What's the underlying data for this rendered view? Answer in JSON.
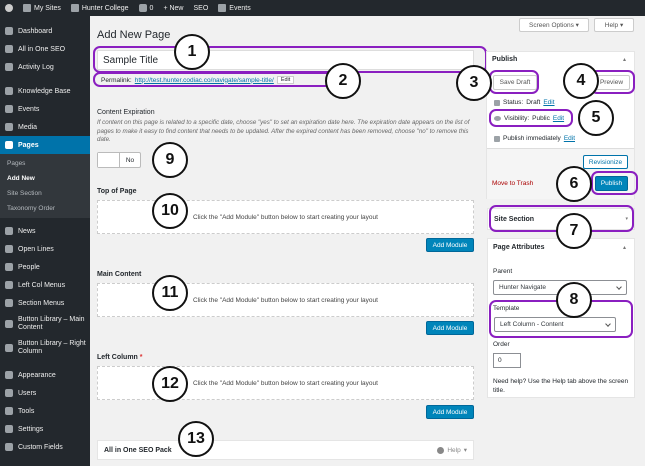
{
  "admin_bar": {
    "my_sites": "My Sites",
    "site_name": "Hunter College",
    "comments_count": "0",
    "new_label": "+ New",
    "seo_label": "SEO",
    "events_label": "Events"
  },
  "sidebar": {
    "items": [
      {
        "label": "Dashboard",
        "icon": "dashboard-icon"
      },
      {
        "label": "All in One SEO",
        "icon": "seo-icon"
      },
      {
        "label": "Activity Log",
        "icon": "clock-icon"
      },
      {
        "label": "Knowledge Base",
        "icon": "book-icon"
      },
      {
        "label": "Events",
        "icon": "calendar-icon"
      },
      {
        "label": "Media",
        "icon": "media-icon"
      },
      {
        "label": "Pages",
        "icon": "pages-icon"
      },
      {
        "label": "News",
        "icon": "news-icon"
      },
      {
        "label": "Open Lines",
        "icon": "chat-icon"
      },
      {
        "label": "People",
        "icon": "people-icon"
      },
      {
        "label": "Left Col Menus",
        "icon": "menu-icon"
      },
      {
        "label": "Section Menus",
        "icon": "menu-icon"
      },
      {
        "label": "Button Library – Main Content",
        "icon": "button-icon"
      },
      {
        "label": "Button Library – Right Column",
        "icon": "button-icon"
      },
      {
        "label": "Appearance",
        "icon": "brush-icon"
      },
      {
        "label": "Users",
        "icon": "user-icon"
      },
      {
        "label": "Tools",
        "icon": "wrench-icon"
      },
      {
        "label": "Settings",
        "icon": "settings-icon"
      },
      {
        "label": "Custom Fields",
        "icon": "fields-icon"
      }
    ],
    "pages_submenu": [
      "Pages",
      "Add New",
      "Site Section",
      "Taxonomy Order"
    ]
  },
  "screen_options": "Screen Options",
  "help": "Help",
  "page_heading": "Add New Page",
  "title_value": "Sample Title",
  "permalink": {
    "label": "Permalink:",
    "url": "http://test.hunter.codiac.co/navigate/sample-title/",
    "edit": "Edit"
  },
  "content_expiration": {
    "heading": "Content Expiration",
    "description": "If content on this page is related to a specific date, choose \"yes\" to set an expiration date here. The expiration date appears on the list of pages to make it easy to find content that needs to be updated. After the expired content has been removed, choose \"no\" to remove this date.",
    "toggle_value": "No"
  },
  "sections": [
    {
      "label": "Top of Page",
      "required": "",
      "placeholder": "Click the \"Add Module\" button below to start creating your layout",
      "button": "Add Module"
    },
    {
      "label": "Main Content",
      "required": "",
      "placeholder": "Click the \"Add Module\" button below to start creating your layout",
      "button": "Add Module"
    },
    {
      "label": "Left Column",
      "required": "*",
      "placeholder": "Click the \"Add Module\" button below to start creating your layout",
      "button": "Add Module"
    }
  ],
  "seo_pack": {
    "title": "All in One SEO Pack",
    "help": "Help"
  },
  "publish": {
    "title": "Publish",
    "save_draft": "Save Draft",
    "preview": "Preview",
    "status_label": "Status:",
    "status_value": "Draft",
    "status_edit": "Edit",
    "visibility_label": "Visibility:",
    "visibility_value": "Public",
    "visibility_edit": "Edit",
    "publish_time": "Publish immediately",
    "publish_edit": "Edit",
    "revisionize": "Revisionize",
    "trash": "Move to Trash",
    "publish_button": "Publish"
  },
  "site_section": {
    "title": "Site Section"
  },
  "page_attributes": {
    "title": "Page Attributes",
    "parent_label": "Parent",
    "parent_value": "Hunter Navigate",
    "template_label": "Template",
    "template_value": "Left Column - Content",
    "order_label": "Order",
    "order_value": "0",
    "help_text": "Need help? Use the Help tab above the screen title."
  },
  "callouts": [
    "1",
    "2",
    "3",
    "4",
    "5",
    "6",
    "7",
    "8",
    "9",
    "10",
    "11",
    "12",
    "13"
  ],
  "colors": {
    "highlight": "#8a1fc0",
    "wp_blue": "#0085ba",
    "sidebar": "#23282d",
    "active_menu": "#0073aa"
  }
}
